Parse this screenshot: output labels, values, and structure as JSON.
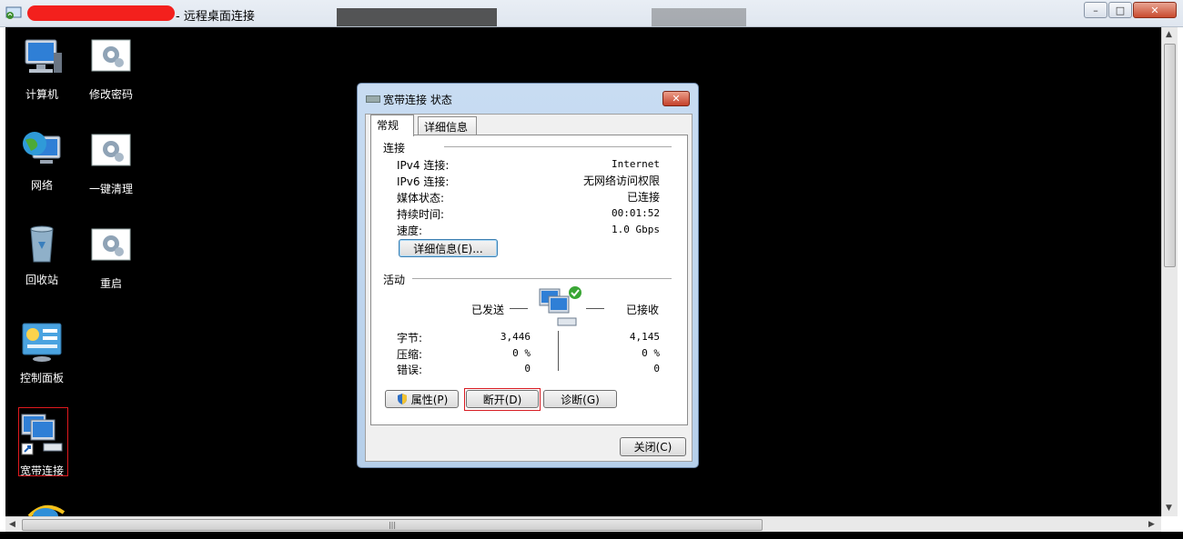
{
  "rdp": {
    "title": "- 远程桌面连接",
    "window_buttons": [
      "minimize",
      "maximize",
      "close"
    ]
  },
  "desktop_icons": [
    {
      "label": "计算机",
      "icon": "computer-icon"
    },
    {
      "label": "修改密码",
      "icon": "gear-shortcut-icon"
    },
    {
      "label": "网络",
      "icon": "network-globe-icon"
    },
    {
      "label": "一键清理",
      "icon": "gear-shortcut-icon"
    },
    {
      "label": "回收站",
      "icon": "recycle-bin-icon"
    },
    {
      "label": "重启",
      "icon": "gear-shortcut-icon"
    },
    {
      "label": "控制面板",
      "icon": "control-panel-icon"
    },
    {
      "label": "宽带连接",
      "icon": "broadband-connection-icon"
    }
  ],
  "dialog": {
    "title": "宽带连接 状态",
    "tabs": [
      "常规",
      "详细信息"
    ],
    "connection": {
      "group": "连接",
      "rows": [
        {
          "label": "IPv4 连接:",
          "value": "Internet"
        },
        {
          "label": "IPv6 连接:",
          "value": "无网络访问权限"
        },
        {
          "label": "媒体状态:",
          "value": "已连接"
        },
        {
          "label": "持续时间:",
          "value": "00:01:52"
        },
        {
          "label": "速度:",
          "value": "1.0 Gbps"
        }
      ],
      "details_button": "详细信息(E)..."
    },
    "activity": {
      "group": "活动",
      "sent_label": "已发送",
      "received_label": "已接收",
      "rows": [
        {
          "label": "字节:",
          "sent": "3,446",
          "received": "4,145"
        },
        {
          "label": "压缩:",
          "sent": "0 %",
          "received": "0 %"
        },
        {
          "label": "错误:",
          "sent": "0",
          "received": "0"
        }
      ]
    },
    "buttons": {
      "properties": "属性(P)",
      "disconnect": "断开(D)",
      "diagnose": "诊断(G)",
      "close": "关闭(C)"
    }
  }
}
